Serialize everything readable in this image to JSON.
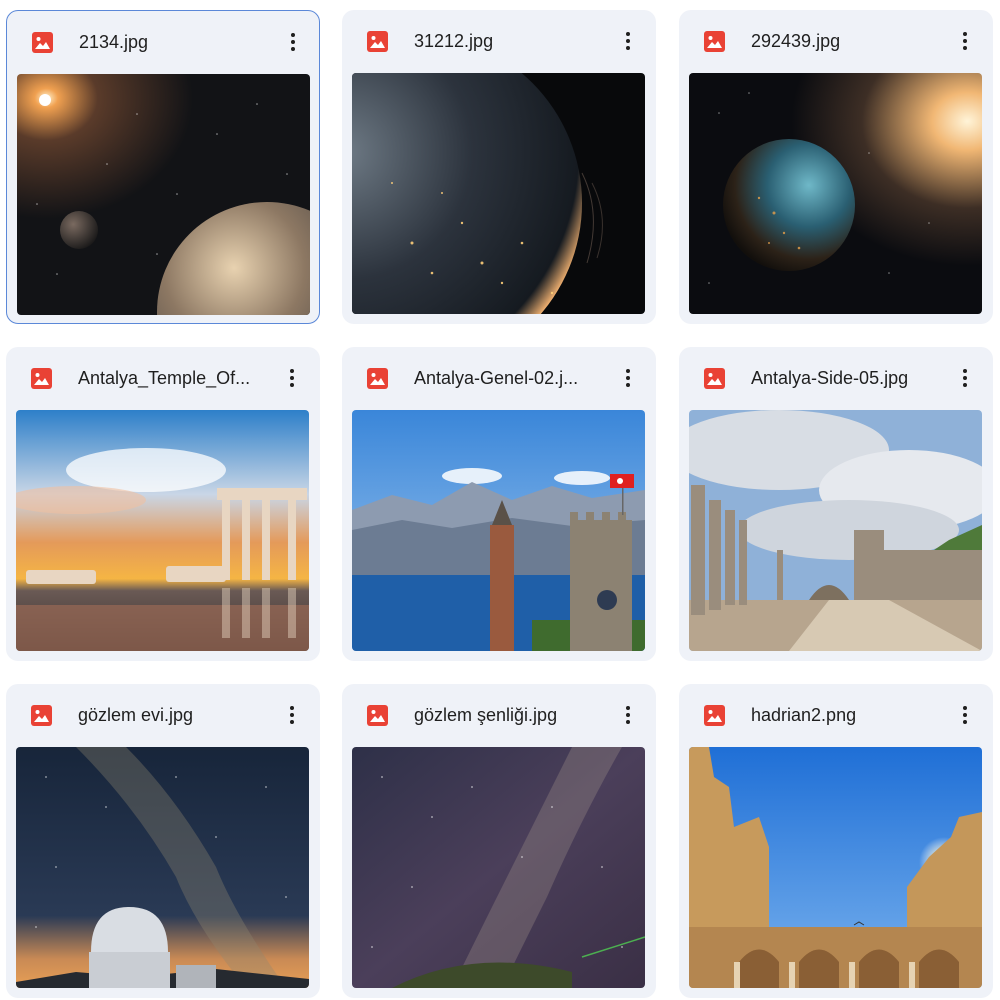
{
  "colors": {
    "card_background": "#eff2f8",
    "selected_border": "#5b88d8",
    "image_icon": "#e94235",
    "text": "#1f1f1f"
  },
  "files": [
    {
      "name": "2134.jpg",
      "type_icon": "image-file-icon",
      "selected": true,
      "thumbnail": "space: sun, small moon and earth"
    },
    {
      "name": "31212.jpg",
      "type_icon": "image-file-icon",
      "selected": false,
      "thumbnail": "space: earth city lights at night"
    },
    {
      "name": "292439.jpg",
      "type_icon": "image-file-icon",
      "selected": false,
      "thumbnail": "space: earth with bright sun"
    },
    {
      "name": "Antalya_Temple_Of...",
      "type_icon": "image-file-icon",
      "selected": false,
      "thumbnail": "temple columns at sunset"
    },
    {
      "name": "Antalya-Genel-02.j...",
      "type_icon": "image-file-icon",
      "selected": false,
      "thumbnail": "mountains, sea, minaret and clock tower"
    },
    {
      "name": "Antalya-Side-05.jpg",
      "type_icon": "image-file-icon",
      "selected": false,
      "thumbnail": "ancient colonnaded street ruins"
    },
    {
      "name": "gözlem evi.jpg",
      "type_icon": "image-file-icon",
      "selected": false,
      "thumbnail": "observatory dome under milky way"
    },
    {
      "name": "gözlem şenliği.jpg",
      "type_icon": "image-file-icon",
      "selected": false,
      "thumbnail": "milky way over hill"
    },
    {
      "name": "hadrian2.png",
      "type_icon": "image-file-icon",
      "selected": false,
      "thumbnail": "hadrian's gate with sun"
    }
  ],
  "more_icon": "more-vert-icon"
}
